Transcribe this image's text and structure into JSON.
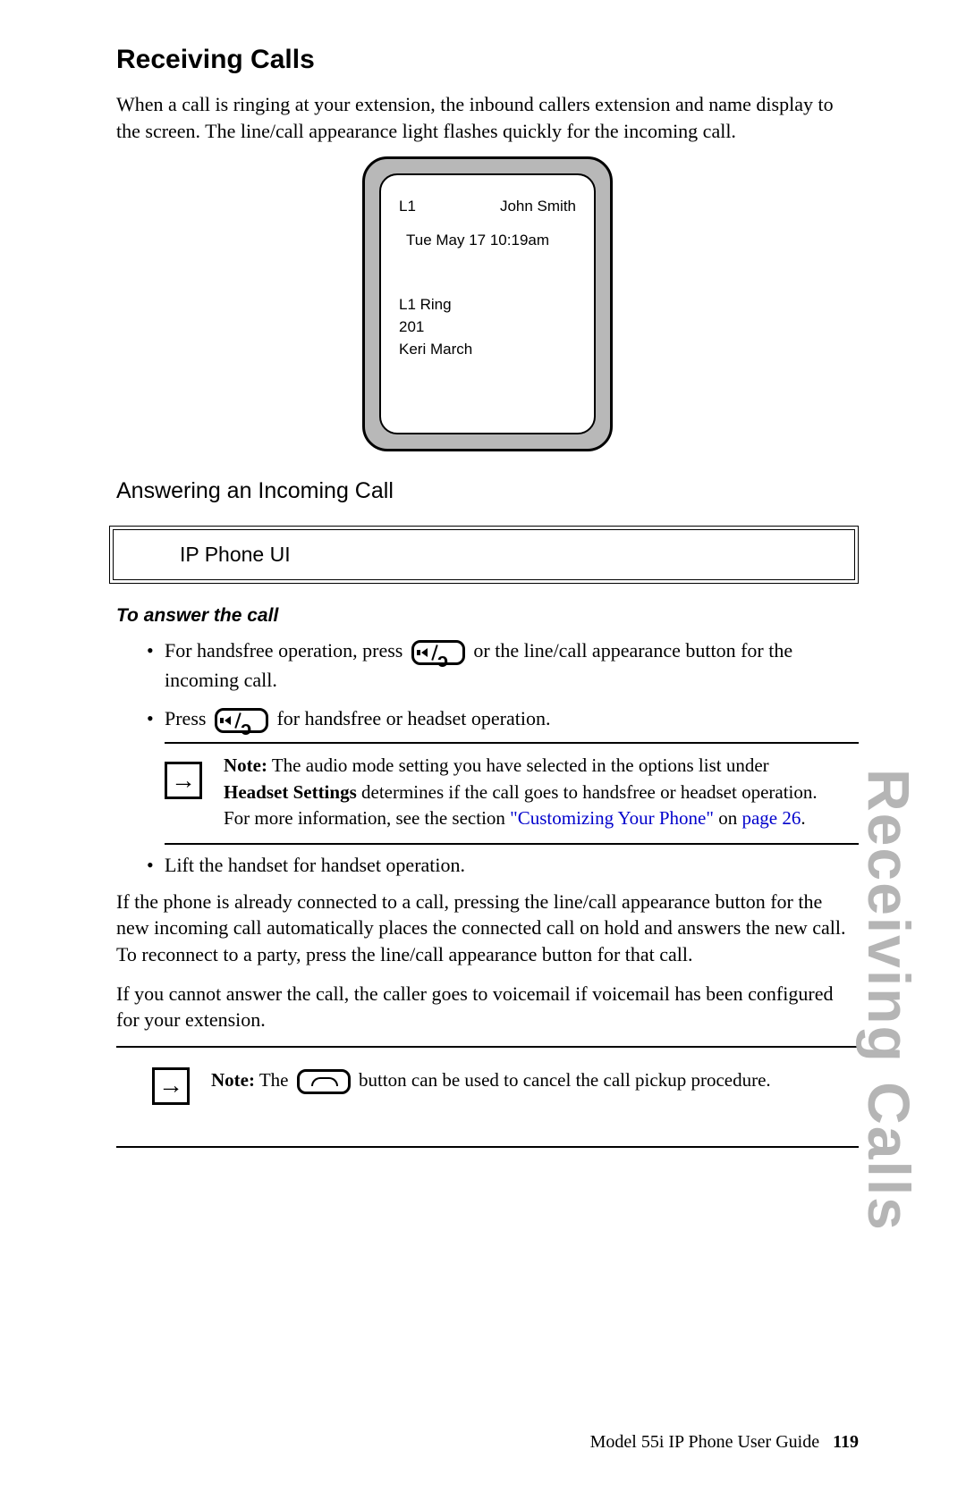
{
  "section_tab": "Receiving Calls",
  "h1": "Receiving Calls",
  "intro": "When a call is ringing at your extension, the inbound callers extension and name display to the screen. The line/call appearance light flashes quickly for the incoming call.",
  "phone": {
    "line": "L1",
    "user": "John Smith",
    "datetime": "Tue May 17 10:19am",
    "status": "L1 Ring",
    "ext": "201",
    "caller": "Keri March"
  },
  "h2": "Answering an Incoming Call",
  "ui_box": "IP Phone UI",
  "h3": "To answer the call",
  "bullets": {
    "b1a": "For handsfree operation, press",
    "b1b": "or the line/call appearance button for the incoming call.",
    "b2a": "Press",
    "b2b": "for handsfree or headset operation.",
    "b3": "Lift the handset for handset operation."
  },
  "note1": {
    "label": "Note:",
    "t1": " The audio mode setting you have selected in the options list under ",
    "bold2": "Headset Settings",
    "t2": " determines if the call goes to handsfree or headset operation. For more information, see the section ",
    "link1": "\"Customizing Your Phone\"",
    "t3": " on ",
    "link2": "page 26",
    "t4": "."
  },
  "para2": "If the phone is already connected to a call, pressing the line/call appearance button for the new incoming call automatically places the connected call on hold and answers the new call. To reconnect to a party, press the line/call appearance button for that call.",
  "para3": "If you cannot answer the call, the caller goes to voicemail if voicemail has been configured for your extension.",
  "note2": {
    "label": "Note:",
    "t1": " The ",
    "t2": " button can be used to cancel the call pickup procedure."
  },
  "footer": {
    "guide": "Model 55i IP Phone User Guide",
    "page": "119"
  }
}
